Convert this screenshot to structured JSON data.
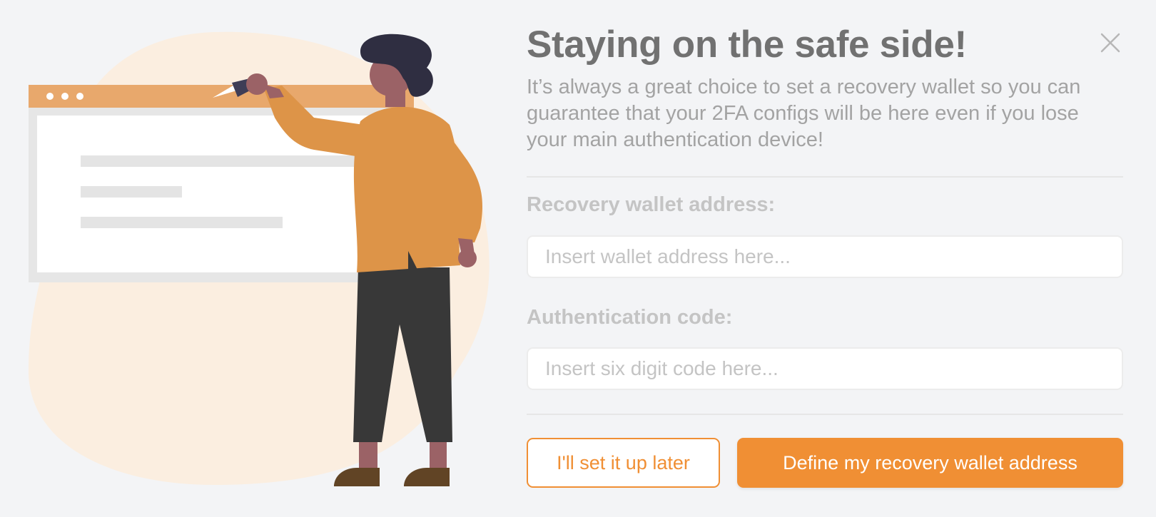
{
  "modal": {
    "title": "Staying on the safe side!",
    "description": "It’s always a great choice to set a recovery wallet so you can guarantee that your 2FA configs will be here even if you lose your main authentication device!",
    "close_icon": "close-icon"
  },
  "form": {
    "wallet_label": "Recovery wallet address:",
    "wallet_placeholder": "Insert wallet address here...",
    "wallet_value": "",
    "code_label": "Authentication code:",
    "code_placeholder": "Insert six digit code here...",
    "code_value": ""
  },
  "actions": {
    "later_label": "I'll set it up later",
    "define_label": "Define my recovery wallet address"
  },
  "colors": {
    "accent": "#f08f34",
    "title": "#717171",
    "text_muted": "#a3a3a3",
    "label": "#c4c4c4",
    "background": "#f3f4f6"
  }
}
